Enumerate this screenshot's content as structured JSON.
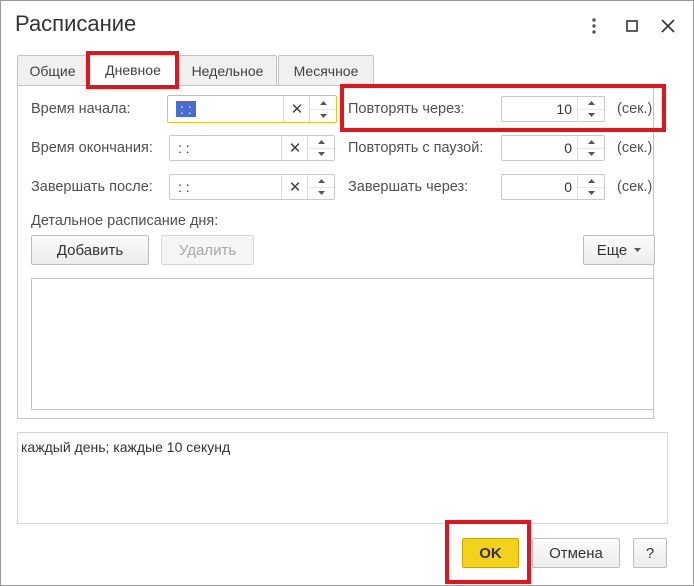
{
  "window": {
    "title": "Расписание",
    "controls": [
      "more-vertical-icon",
      "maximize-icon",
      "close-icon"
    ]
  },
  "tabs": [
    {
      "label": "Общие",
      "active": false
    },
    {
      "label": "Дневное",
      "active": true
    },
    {
      "label": "Недельное",
      "active": false
    },
    {
      "label": "Месячное",
      "active": false
    }
  ],
  "daily": {
    "start_time": {
      "label": "Время начала:",
      "value": ": :"
    },
    "end_time": {
      "label": "Время окончания:",
      "value": ": :"
    },
    "finish_after": {
      "label": "Завершать после:",
      "value": ": :"
    },
    "repeat_every": {
      "label": "Повторять через:",
      "value": "10",
      "unit": "(сек.)"
    },
    "repeat_pause": {
      "label": "Повторять с паузой:",
      "value": "0",
      "unit": "(сек.)"
    },
    "finish_in": {
      "label": "Завершать через:",
      "value": "0",
      "unit": "(сек.)"
    },
    "detail_label": "Детальное расписание дня:",
    "add_button": "Добавить",
    "delete_button": "Удалить",
    "more_button": "Еще"
  },
  "summary": "каждый день; каждые 10 секунд",
  "footer": {
    "ok": "OK",
    "cancel": "Отмена",
    "help": "?"
  },
  "colors": {
    "highlight": "#e3141e",
    "ok_button": "#f4d21c",
    "focus_border": "#f0c419",
    "selection": "#4a6bd0"
  }
}
